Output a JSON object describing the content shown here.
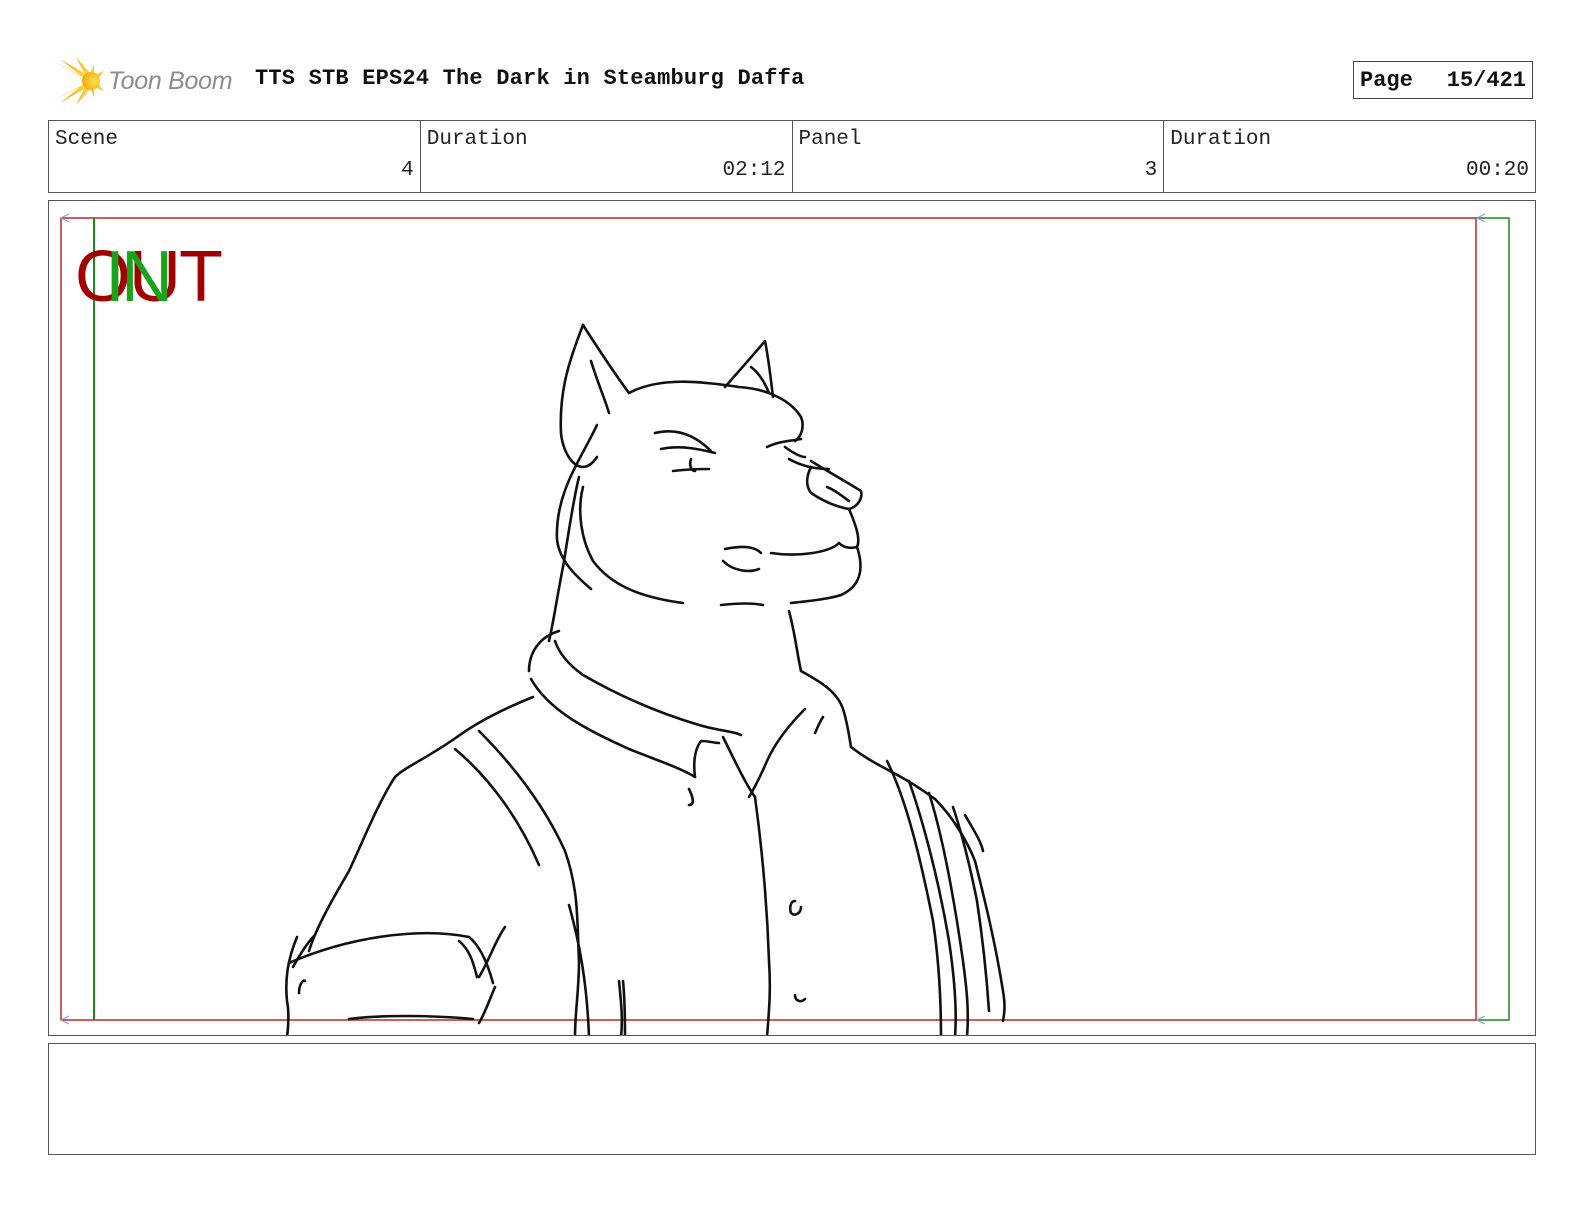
{
  "header": {
    "logo_text": "Toon Boom",
    "title": "TTS STB EPS24 The Dark in Steamburg Daffa",
    "page_label": "Page",
    "page_number": "15/421"
  },
  "info": [
    {
      "label": "Scene",
      "value": "4"
    },
    {
      "label": "Duration",
      "value": "02:12"
    },
    {
      "label": "Panel",
      "value": "3"
    },
    {
      "label": "Duration",
      "value": "00:20"
    }
  ],
  "panel": {
    "label_out": "OUT",
    "label_in": "IN",
    "colors": {
      "out_frame": "#cc2222",
      "in_frame": "#1a8a1a",
      "arrow": "#8aa0d8",
      "sketch": "#111111"
    },
    "drawing": "dog-character-sketch"
  },
  "notes": {
    "text": ""
  }
}
